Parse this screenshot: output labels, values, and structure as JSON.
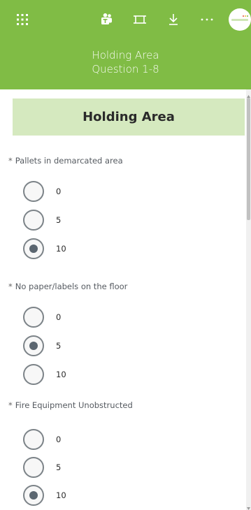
{
  "toolbar": {
    "icons": [
      "app-launcher-icon",
      "teams-icon",
      "fit-screen-icon",
      "download-icon",
      "more-icon"
    ],
    "accent_color": "#80bc45"
  },
  "header": {
    "title": "Holding Area",
    "subtitle": "Question 1-8"
  },
  "section": {
    "title": "Holding Area"
  },
  "questions": [
    {
      "required": "*",
      "label": "Pallets in demarcated area",
      "options": [
        "0",
        "5",
        "10"
      ],
      "selected": "10"
    },
    {
      "required": "*",
      "label": "No paper/labels on the floor",
      "options": [
        "0",
        "5",
        "10"
      ],
      "selected": "5"
    },
    {
      "required": "*",
      "label": "Fire Equipment Unobstructed",
      "options": [
        "0",
        "5",
        "10"
      ],
      "selected": "10"
    }
  ]
}
